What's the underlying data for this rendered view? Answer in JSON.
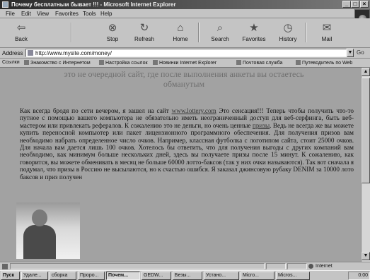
{
  "window": {
    "title": "Почему бесплатным бывает !!! - Microsoft Internet Explorer",
    "minimize": "_",
    "maximize": "□",
    "close": "×"
  },
  "menu": [
    "File",
    "Edit",
    "View",
    "Favorites",
    "Tools",
    "Help"
  ],
  "toolbar": [
    {
      "label": "Back",
      "icon": "back-arrow-icon",
      "glyph": "⇦"
    },
    {
      "label": "Stop",
      "icon": "stop-icon",
      "glyph": "⊗"
    },
    {
      "label": "Refresh",
      "icon": "refresh-icon",
      "glyph": "↻"
    },
    {
      "label": "Home",
      "icon": "home-icon",
      "glyph": "⌂"
    },
    {
      "label": "Search",
      "icon": "search-icon",
      "glyph": "⌕"
    },
    {
      "label": "Favorites",
      "icon": "favorites-icon",
      "glyph": "★"
    },
    {
      "label": "History",
      "icon": "history-icon",
      "glyph": "◷"
    },
    {
      "label": "Mail",
      "icon": "mail-icon",
      "glyph": "✉"
    }
  ],
  "address": {
    "label": "Address",
    "url": "http://www.mysite.com/money/",
    "go": "Go"
  },
  "links": {
    "label": "Ссылки",
    "items": [
      "Знакомство с Интернетом",
      "Настройка ссылок",
      "Новинки Internet Explorer",
      "Почтовая служба",
      "Путеводитель по Web"
    ]
  },
  "content": {
    "heading": "это не очередной сайт, где после выполнения анкеты вы остаетесь обманутым",
    "p_start": "Как всегда бродя по сети вечером, я зашел на сайт ",
    "link1": "www.lottery.com",
    "p_mid": " Это сенсация!!! Теперь чтобы получить что-то путное с помощью вашего компьютера не обязательно иметь неограниченный доступ для веб-серфинга, быть веб-мастером или привлекать рефералов. К сожалению это не деньги, но очень ценные ",
    "link2": "призы",
    "p_end": ". Ведь не всегда же вы можете купить переносной компьютер или пакет лицензионного программного обеспечения. Для получения призов вам необходимо набрать определенное число очков. Например, классная футболка с логотипом сайта, стоит 25000 очков. Для начала вам дается лишь 100 очков. Хотелось бы ответить, что для получения выгоды с других компаний вам необходимо, как минимум больше нескольких дней, здесь вы получаете призы после 15 минут. К сожалению, как говорится, вы можете обменивать в месяц не больше 60000 лотто-баксов (так у них очки называются). Так вот сначала я подумал, что призы в Россию не высылаются, но к счастью ошибся. Я заказал джинсовую рубаку DENIM за 10000 лото баксов и приз получен"
  },
  "status": {
    "text": "",
    "zone": "Internet"
  },
  "taskbar": {
    "start": "Пуск",
    "items": [
      "Удале...",
      "сборка",
      "Проро...",
      "Почем...",
      "GEDW...",
      "Безы...",
      "Устано...",
      "Micro...",
      "Micros..."
    ],
    "active_index": 3,
    "clock": "0:00"
  }
}
